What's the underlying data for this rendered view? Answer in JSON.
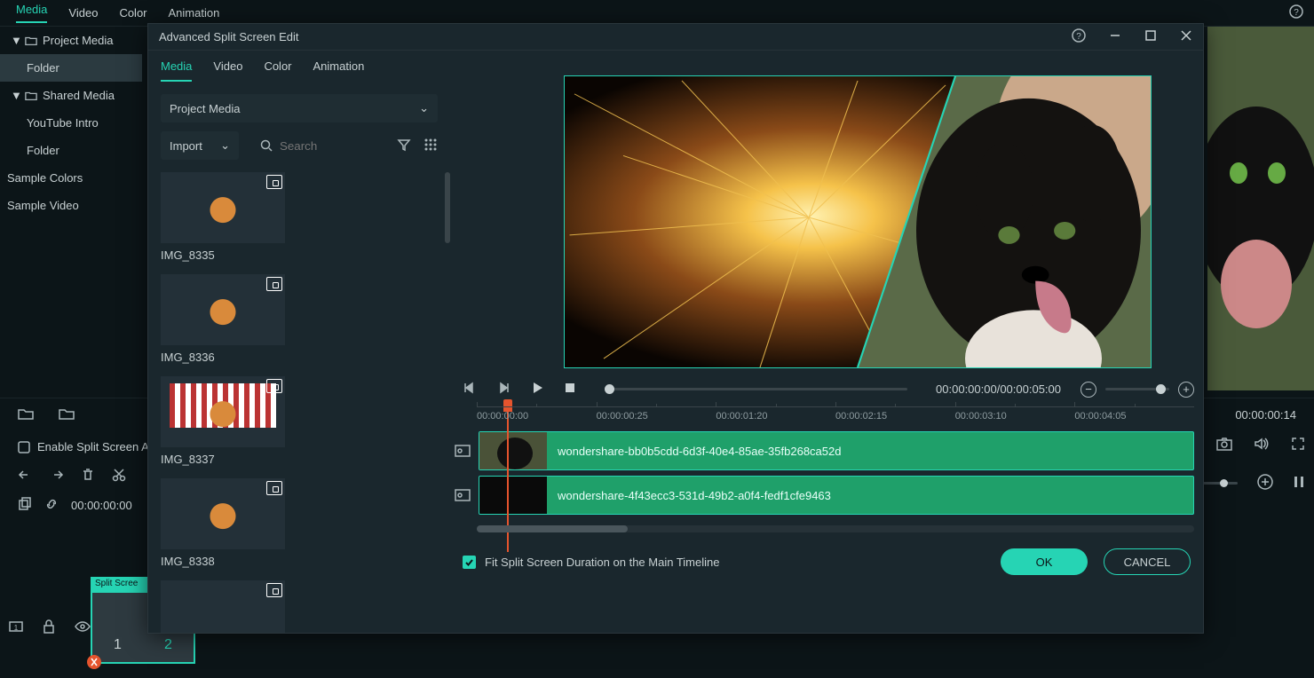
{
  "bg_tabs": {
    "t0": "Media",
    "t1": "Video",
    "t2": "Color",
    "t3": "Animation"
  },
  "bg_tree": {
    "project": "Project Media",
    "folder": "Folder",
    "shared": "Shared Media",
    "yt": "YouTube Intro",
    "folder2": "Folder",
    "sample_colors": "Sample Colors",
    "sample_video": "Sample Video"
  },
  "bg": {
    "enable_split": "Enable Split Screen An",
    "timecode": "00:00:00:00",
    "right_time": "00:00:00:14",
    "clip_label": "Split Scree",
    "n1": "1",
    "n2": "2"
  },
  "modal": {
    "title": "Advanced Split Screen Edit",
    "tabs": {
      "t0": "Media",
      "t1": "Video",
      "t2": "Color",
      "t3": "Animation"
    },
    "project_drop": "Project Media",
    "import": "Import",
    "search_ph": "Search",
    "thumbs": {
      "a": "IMG_8335",
      "b": "IMG_8336",
      "c": "IMG_8337",
      "d": "IMG_8338"
    },
    "timecode": "00:00:00:00/00:00:05:00",
    "ruler": {
      "r0": "00:00:00:00",
      "r1": "00:00:00:25",
      "r2": "00:00:01:20",
      "r3": "00:00:02:15",
      "r4": "00:00:03:10",
      "r5": "00:00:04:05"
    },
    "clip1": "wondershare-bb0b5cdd-6d3f-40e4-85ae-35fb268ca52d",
    "clip2": "wondershare-4f43ecc3-531d-49b2-a0f4-fedf1cfe9463",
    "fit": "Fit Split Screen Duration on the Main Timeline",
    "ok": "OK",
    "cancel": "CANCEL"
  }
}
